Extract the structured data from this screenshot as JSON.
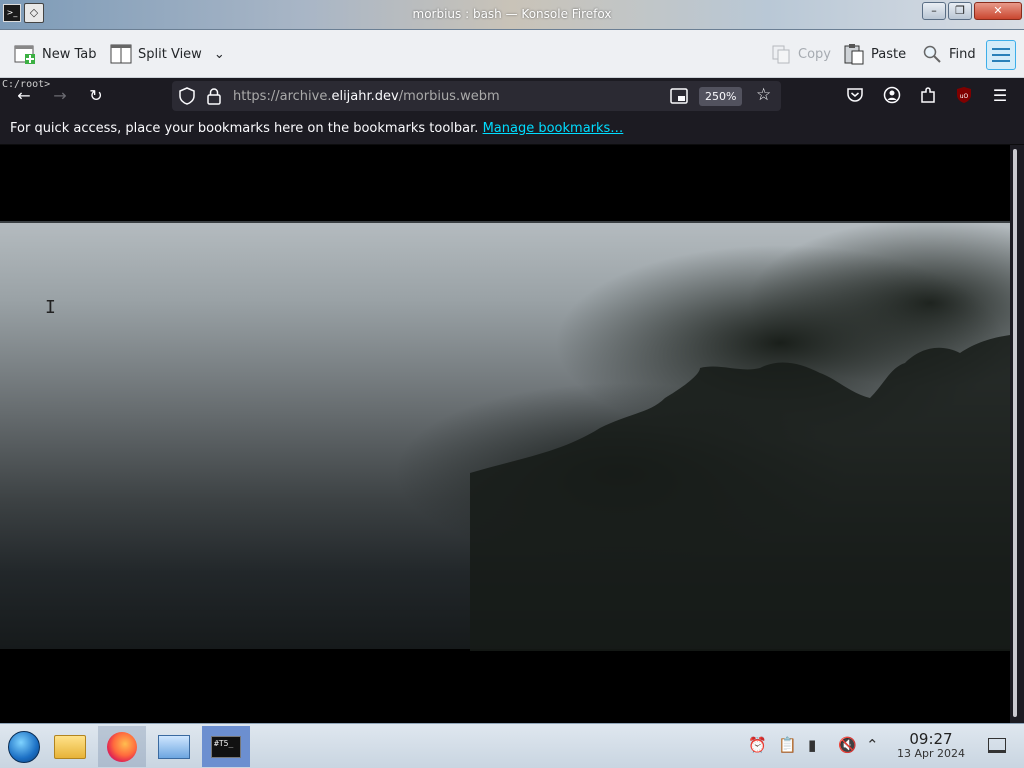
{
  "window": {
    "title_overlap_a": "morbius",
    "title": "bash — Konsole",
    "title_overlap_b": "Firefox",
    "title_full": "morbius : bash — Konsole Firefox",
    "controls": [
      "minimize",
      "maximize",
      "close"
    ]
  },
  "konsole_toolbar": {
    "new_tab": "New Tab",
    "split_view": "Split View",
    "copy": "Copy",
    "paste": "Paste",
    "find": "Find"
  },
  "terminal": {
    "prompt": "C:/root>"
  },
  "browser": {
    "url_prefix": "https://archive.",
    "url_host": "elijahr.dev",
    "url_path": "/morbius.webm",
    "zoom": "250%",
    "bookmarks_message": "For quick access, place your bookmarks here on the bookmarks toolbar.",
    "manage_bookmarks": "Manage bookmarks…"
  },
  "taskbar": {
    "time": "09:27",
    "date": "13 Apr 2024",
    "terminal_label": "#T5_"
  },
  "colors": {
    "browser_bg": "#1c1b22",
    "urlbar_bg": "#2b2a33",
    "link": "#00ddff",
    "konsole_accent": "#3daee9"
  }
}
